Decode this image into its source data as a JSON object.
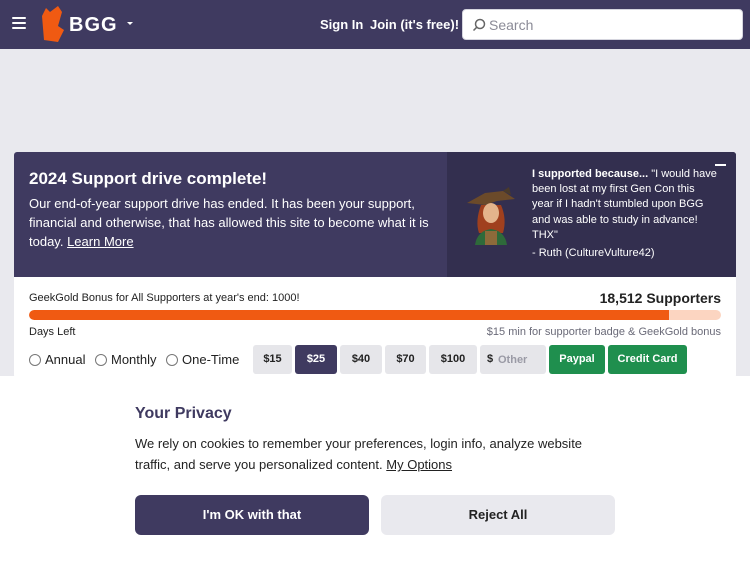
{
  "header": {
    "logo_text": "BGG",
    "sign_in": "Sign In",
    "join": "Join (it's free)!",
    "search_placeholder": "Search"
  },
  "support_drive": {
    "title": "2024 Support drive complete!",
    "body": "Our end-of-year support drive has ended. It has been your support, financial and otherwise, that has allowed this site to become what it is today.",
    "learn_more": "Learn More",
    "quote_lead": "I supported because...",
    "quote": "\"I would have been lost at my first Gen Con this year if I hadn't stumbled upon BGG and was able to study in advance! THX\"",
    "quote_author": "- Ruth (CultureVulture42)",
    "bonus_text": "GeekGold Bonus for All Supporters at year's end: 1000!",
    "supporters": "18,512 Supporters",
    "progress_fraction": 0.925,
    "days_left": "Days Left",
    "min_note": "$15 min for supporter badge & GeekGold bonus",
    "frequencies": [
      "Annual",
      "Monthly",
      "One-Time"
    ],
    "amounts": [
      "$15",
      "$25",
      "$40",
      "$70",
      "$100"
    ],
    "selected_amount": "$25",
    "other_prefix": "$",
    "other_placeholder": "Other",
    "paypal": "Paypal",
    "credit_card": "Credit Card"
  },
  "privacy": {
    "title": "Your Privacy",
    "text": "We rely on cookies to remember your preferences, login info, analyze website traffic, and serve you personalized content.",
    "my_options": "My Options",
    "ok": "I'm OK with that",
    "reject": "Reject All"
  },
  "colors": {
    "brand_purple": "#3f3a60",
    "accent_orange": "#f05a12",
    "pay_green": "#1f8f4e"
  }
}
